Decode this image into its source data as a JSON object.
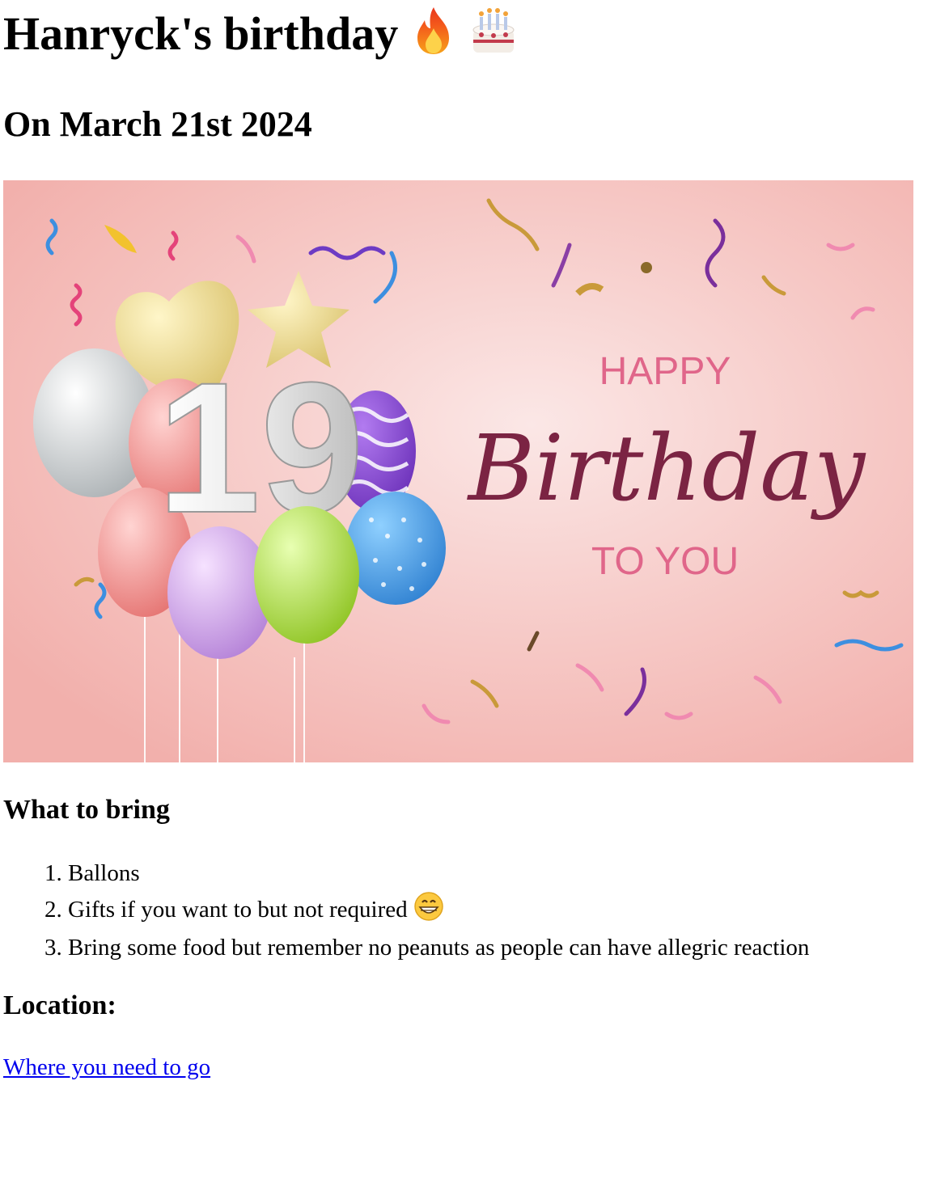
{
  "page": {
    "title": "Hanryck's birthday",
    "title_icons": [
      "fire-icon",
      "birthday-cake-icon"
    ],
    "subtitle": "On March 21st 2024"
  },
  "banner": {
    "number": "19",
    "happy": "HAPPY",
    "birthday": "Birthday",
    "to_you": "TO YOU",
    "colors": {
      "background": "#f4b9b6",
      "happy_text": "#e0668a",
      "birthday_text": "#7b2443"
    }
  },
  "bring": {
    "heading": "What to bring",
    "items": [
      "Ballons",
      "Gifts if you want to but not required",
      "Bring some food but remember no peanuts as people can have allegric reaction"
    ],
    "item2_icon": "grinning-face-icon"
  },
  "location": {
    "heading": "Location:",
    "link_text": "Where you need to go",
    "link_color": "#0000ee"
  }
}
